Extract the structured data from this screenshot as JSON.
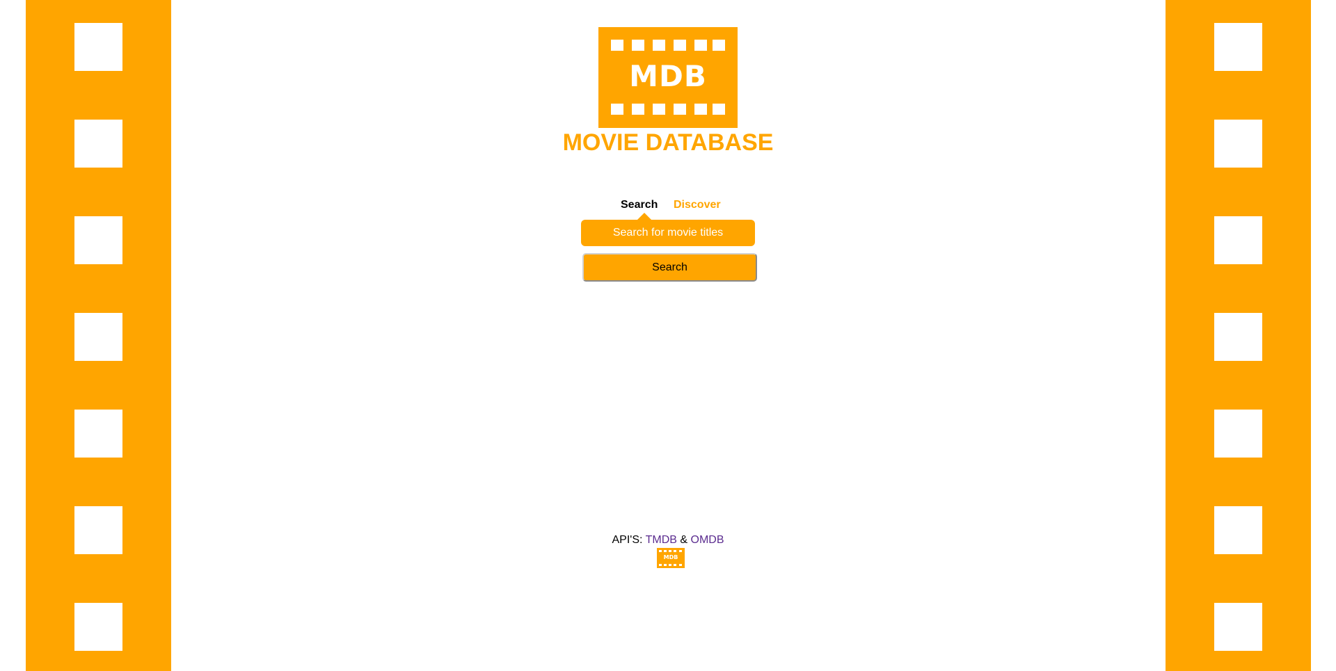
{
  "colors": {
    "accent": "#ffa500",
    "background": "#ffffff",
    "link": "#5b2c8f",
    "text": "#000000"
  },
  "header": {
    "logo_text": "MDB",
    "site_title": "MOVIE DATABASE"
  },
  "tabs": [
    {
      "label": "Search",
      "active": true
    },
    {
      "label": "Discover",
      "active": false
    }
  ],
  "search": {
    "placeholder": "Search for movie titles",
    "value": "",
    "button_label": "Search"
  },
  "footer": {
    "api_label": "API'S:",
    "tmdb_link": "TMDB",
    "separator": "&",
    "omdb_link": "OMDB",
    "logo_text": "MDB"
  },
  "icons": {
    "film_strip": "film-strip-decoration",
    "logo": "mdb-logo-icon"
  }
}
